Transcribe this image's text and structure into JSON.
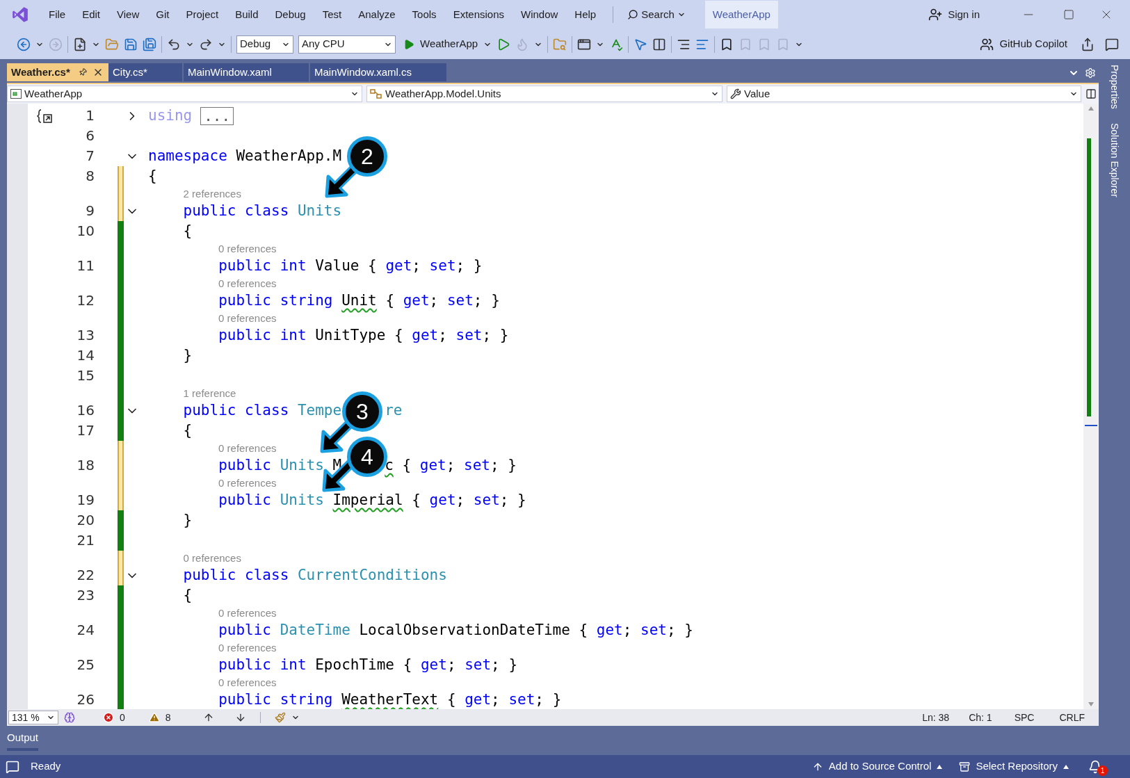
{
  "menu": [
    "File",
    "Edit",
    "View",
    "Git",
    "Project",
    "Build",
    "Debug",
    "Test",
    "Analyze",
    "Tools",
    "Extensions",
    "Window",
    "Help"
  ],
  "search": "Search",
  "solution": "WeatherApp",
  "sign_in": "Sign in",
  "toolbar": {
    "configuration": "Debug",
    "platform": "Any CPU",
    "start_target": "WeatherApp",
    "copilot": "GitHub Copilot"
  },
  "tabs": [
    {
      "label": "Weather.cs*",
      "selected": true
    },
    {
      "label": "City.cs*",
      "selected": false
    },
    {
      "label": "MainWindow.xaml",
      "selected": false
    },
    {
      "label": "MainWindow.xaml.cs",
      "selected": false
    }
  ],
  "navigation": {
    "project": "WeatherApp",
    "type": "WeatherApp.Model.Units",
    "member": "Value"
  },
  "side_tabs": [
    "Properties",
    "Solution Explorer"
  ],
  "lines": [
    {
      "number": "1",
      "expanded": false,
      "scope_marker": true,
      "tokens": [
        {
          "text": "using",
          "kind": "collapsed"
        },
        {
          "text": "...",
          "kind": "ellipsis"
        }
      ]
    },
    {
      "number": "6"
    },
    {
      "number": "7",
      "expanded": true,
      "tokens": [
        {
          "text": "namespace ",
          "kind": "keyword"
        },
        {
          "text": "WeatherApp.M",
          "kind": "text"
        }
      ]
    },
    {
      "number": "8",
      "saved": false,
      "tokens": [
        {
          "text": "{",
          "kind": "text"
        }
      ]
    },
    {
      "number": "9",
      "expanded": true,
      "saved": false,
      "codelens": "2 references",
      "tokens": [
        {
          "text": "    public class ",
          "kind": "keyword"
        },
        {
          "text": "Units",
          "kind": "type"
        }
      ]
    },
    {
      "number": "10",
      "saved": true,
      "tokens": [
        {
          "text": "    {",
          "kind": "text"
        }
      ]
    },
    {
      "number": "11",
      "saved": true,
      "codelens": "0 references",
      "tokens": [
        {
          "text": "        public int ",
          "kind": "keyword"
        },
        {
          "text": "Value { ",
          "kind": "text"
        },
        {
          "text": "get",
          "kind": "keyword"
        },
        {
          "text": "; ",
          "kind": "text"
        },
        {
          "text": "set",
          "kind": "keyword"
        },
        {
          "text": "; }",
          "kind": "text"
        }
      ]
    },
    {
      "number": "12",
      "saved": true,
      "codelens": "0 references",
      "tokens": [
        {
          "text": "        public string ",
          "kind": "keyword"
        },
        {
          "text": "Unit",
          "kind": "text",
          "squiggle": true
        },
        {
          "text": " { ",
          "kind": "text"
        },
        {
          "text": "get",
          "kind": "keyword"
        },
        {
          "text": "; ",
          "kind": "text"
        },
        {
          "text": "set",
          "kind": "keyword"
        },
        {
          "text": "; }",
          "kind": "text"
        }
      ]
    },
    {
      "number": "13",
      "saved": true,
      "codelens": "0 references",
      "tokens": [
        {
          "text": "        public int ",
          "kind": "keyword"
        },
        {
          "text": "UnitType { ",
          "kind": "text"
        },
        {
          "text": "get",
          "kind": "keyword"
        },
        {
          "text": "; ",
          "kind": "text"
        },
        {
          "text": "set",
          "kind": "keyword"
        },
        {
          "text": "; }",
          "kind": "text"
        }
      ]
    },
    {
      "number": "14",
      "saved": true,
      "tokens": [
        {
          "text": "    }",
          "kind": "text"
        }
      ]
    },
    {
      "number": "15",
      "saved": true
    },
    {
      "number": "16",
      "expanded": true,
      "saved": true,
      "codelens": "1 reference",
      "tokens": [
        {
          "text": "    public class ",
          "kind": "keyword"
        },
        {
          "text": "Tempe",
          "kind": "type"
        },
        {
          "text": "re",
          "kind": "type",
          "after_callout": true
        }
      ]
    },
    {
      "number": "17",
      "saved": true,
      "tokens": [
        {
          "text": "    {",
          "kind": "text"
        }
      ]
    },
    {
      "number": "18",
      "saved": false,
      "codelens": "0 references",
      "tokens": [
        {
          "text": "        public ",
          "kind": "keyword"
        },
        {
          "text": "Units",
          "kind": "type"
        },
        {
          "text": " M",
          "kind": "text"
        },
        {
          "text": "c",
          "kind": "text",
          "squiggle": true,
          "after_callout": true
        },
        {
          "text": " { ",
          "kind": "text"
        },
        {
          "text": "get",
          "kind": "keyword"
        },
        {
          "text": "; ",
          "kind": "text"
        },
        {
          "text": "set",
          "kind": "keyword"
        },
        {
          "text": "; }",
          "kind": "text"
        }
      ]
    },
    {
      "number": "19",
      "saved": false,
      "codelens": "0 references",
      "tokens": [
        {
          "text": "        public ",
          "kind": "keyword"
        },
        {
          "text": "Units ",
          "kind": "type"
        },
        {
          "text": "Imperial",
          "kind": "text",
          "squiggle": true
        },
        {
          "text": " { ",
          "kind": "text"
        },
        {
          "text": "get",
          "kind": "keyword"
        },
        {
          "text": "; ",
          "kind": "text"
        },
        {
          "text": "set",
          "kind": "keyword"
        },
        {
          "text": "; }",
          "kind": "text"
        }
      ]
    },
    {
      "number": "20",
      "saved": true,
      "tokens": [
        {
          "text": "    }",
          "kind": "text"
        }
      ]
    },
    {
      "number": "21",
      "saved": true
    },
    {
      "number": "22",
      "expanded": true,
      "saved": false,
      "codelens": "0 references",
      "tokens": [
        {
          "text": "    public class ",
          "kind": "keyword"
        },
        {
          "text": "CurrentConditions",
          "kind": "type"
        }
      ]
    },
    {
      "number": "23",
      "saved": true,
      "tokens": [
        {
          "text": "    {",
          "kind": "text"
        }
      ]
    },
    {
      "number": "24",
      "saved": true,
      "codelens": "0 references",
      "tokens": [
        {
          "text": "        public ",
          "kind": "keyword"
        },
        {
          "text": "DateTime",
          "kind": "type"
        },
        {
          "text": " LocalObservationDateTime { ",
          "kind": "text"
        },
        {
          "text": "get",
          "kind": "keyword"
        },
        {
          "text": "; ",
          "kind": "text"
        },
        {
          "text": "set",
          "kind": "keyword"
        },
        {
          "text": "; }",
          "kind": "text"
        }
      ]
    },
    {
      "number": "25",
      "saved": true,
      "codelens": "0 references",
      "tokens": [
        {
          "text": "        public int ",
          "kind": "keyword"
        },
        {
          "text": "EpochTime { ",
          "kind": "text"
        },
        {
          "text": "get",
          "kind": "keyword"
        },
        {
          "text": "; ",
          "kind": "text"
        },
        {
          "text": "set",
          "kind": "keyword"
        },
        {
          "text": "; }",
          "kind": "text"
        }
      ]
    },
    {
      "number": "26",
      "saved": true,
      "codelens": "0 references",
      "tokens": [
        {
          "text": "        public string ",
          "kind": "keyword"
        },
        {
          "text": "WeatherText",
          "kind": "text",
          "squiggle": true
        },
        {
          "text": " { ",
          "kind": "text"
        },
        {
          "text": "get",
          "kind": "keyword"
        },
        {
          "text": "; ",
          "kind": "text"
        },
        {
          "text": "set",
          "kind": "keyword"
        },
        {
          "text": "; }",
          "kind": "text"
        }
      ]
    }
  ],
  "callouts": [
    {
      "label": "2"
    },
    {
      "label": "3"
    },
    {
      "label": "4"
    }
  ],
  "editor_status": {
    "zoom": "131 %",
    "errors": "0",
    "warnings": "8",
    "line": "Ln: 38",
    "column": "Ch: 1",
    "whitespace": "SPC",
    "line_endings": "CRLF"
  },
  "output_tab": "Output",
  "status_bar": {
    "message": "Ready",
    "source_control": "Add to Source Control",
    "repository": "Select Repository",
    "notifications": "1"
  }
}
